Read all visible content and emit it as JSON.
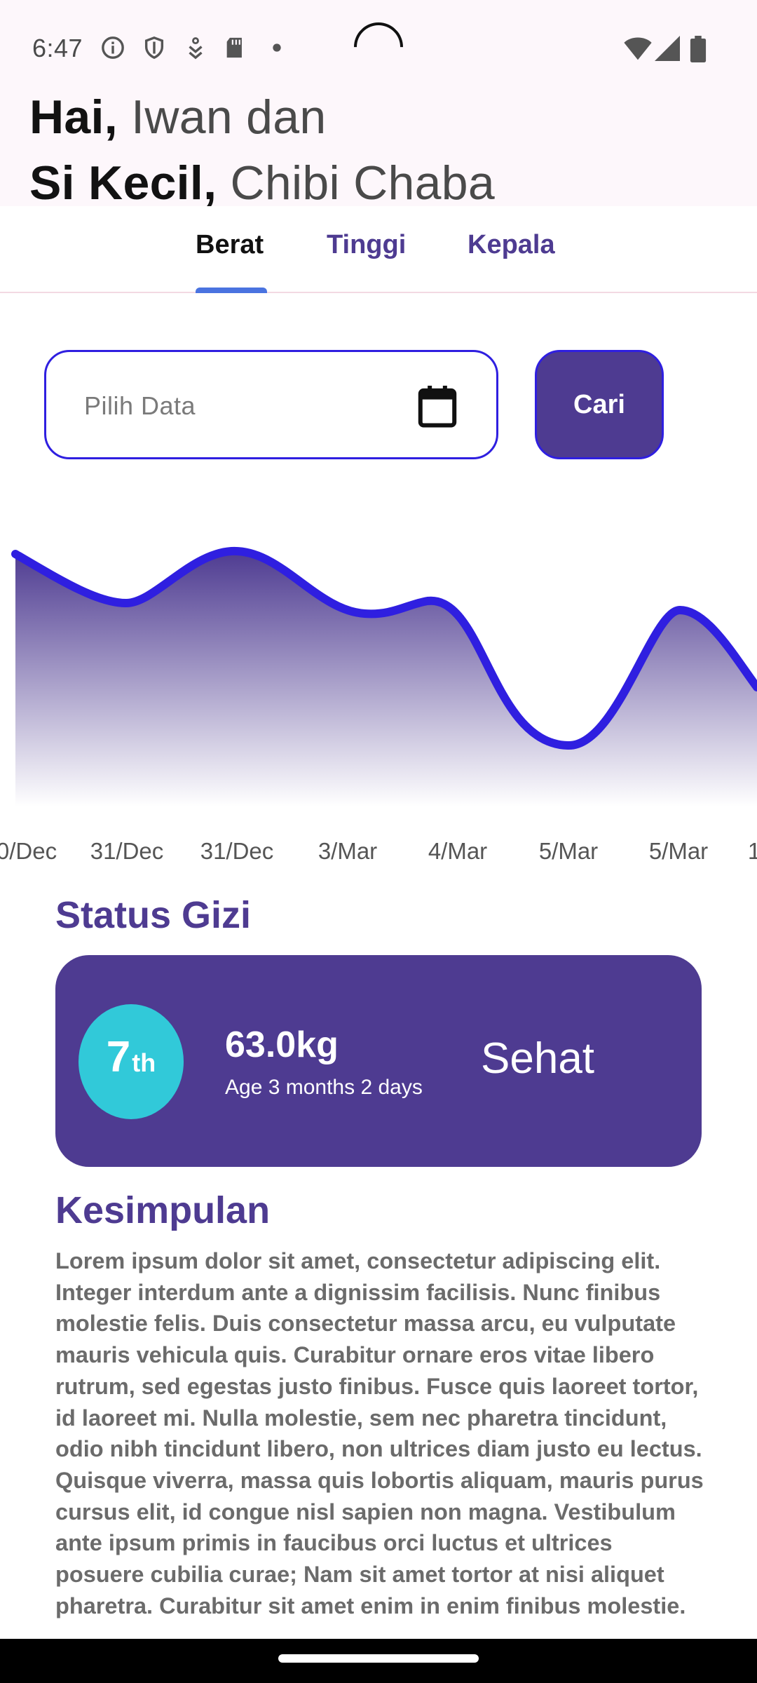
{
  "status_bar": {
    "time": "6:47",
    "icons_left": [
      "info-icon",
      "shield-icon",
      "download-icon",
      "sd-card-icon",
      "dot-icon"
    ],
    "icons_right": [
      "wifi-icon",
      "signal-icon",
      "battery-icon"
    ]
  },
  "greeting": {
    "line1_prefix": "Hai,",
    "line1_name": "Iwan dan",
    "line2_prefix": "Si Kecil,",
    "line2_name": "Chibi Chaba"
  },
  "tabs": [
    {
      "label": "Berat",
      "active": true
    },
    {
      "label": "Tinggi",
      "active": false
    },
    {
      "label": "Kepala",
      "active": false
    }
  ],
  "search": {
    "placeholder": "Pilih Data",
    "button_label": "Cari"
  },
  "chart_data": {
    "type": "area",
    "x": [
      "",
      "31/Dec",
      "31/Dec",
      "3/Mar",
      "4/Mar",
      "5/Mar",
      "5/Mar",
      ""
    ],
    "visible_tick_labels": [
      "0/Dec",
      "31/Dec",
      "31/Dec",
      "3/Mar",
      "4/Mar",
      "5/Mar",
      "5/Mar",
      "1"
    ],
    "title": "",
    "xlabel": "",
    "ylabel": "",
    "line_color": "#2f1fe0",
    "fill_color_top": "#4e3b91",
    "fill_color_bottom": "#ffffff",
    "grid": false
  },
  "status_gizi": {
    "title": "Status Gizi",
    "percentile_number": "7",
    "percentile_suffix": "th",
    "weight": "63.0kg",
    "age": "Age 3 months 2 days",
    "status": "Sehat"
  },
  "kesimpulan": {
    "title": "Kesimpulan",
    "body": "Lorem ipsum dolor sit amet, consectetur adipiscing elit. Integer interdum ante a dignissim facilisis. Nunc finibus molestie felis. Duis consectetur massa arcu, eu vulputate mauris vehicula quis. Curabitur ornare eros vitae libero rutrum, sed egestas justo finibus. Fusce quis laoreet tortor, id laoreet mi. Nulla molestie, sem nec pharetra tincidunt, odio nibh tincidunt libero, non ultrices diam justo eu lectus. Quisque viverra, massa quis lobortis aliquam, mauris purus cursus elit, id congue nisl sapien non magna. Vestibulum ante ipsum primis in faucibus orci luctus et ultrices posuere cubilia curae; Nam sit amet tortor at nisi aliquet pharetra. Curabitur sit amet enim in enim finibus molestie."
  },
  "colors": {
    "primary": "#4e3b91",
    "accent_blue": "#2f1fe0",
    "percentile_circle": "#31c9d9",
    "tab_indicator": "#4a73e0"
  }
}
